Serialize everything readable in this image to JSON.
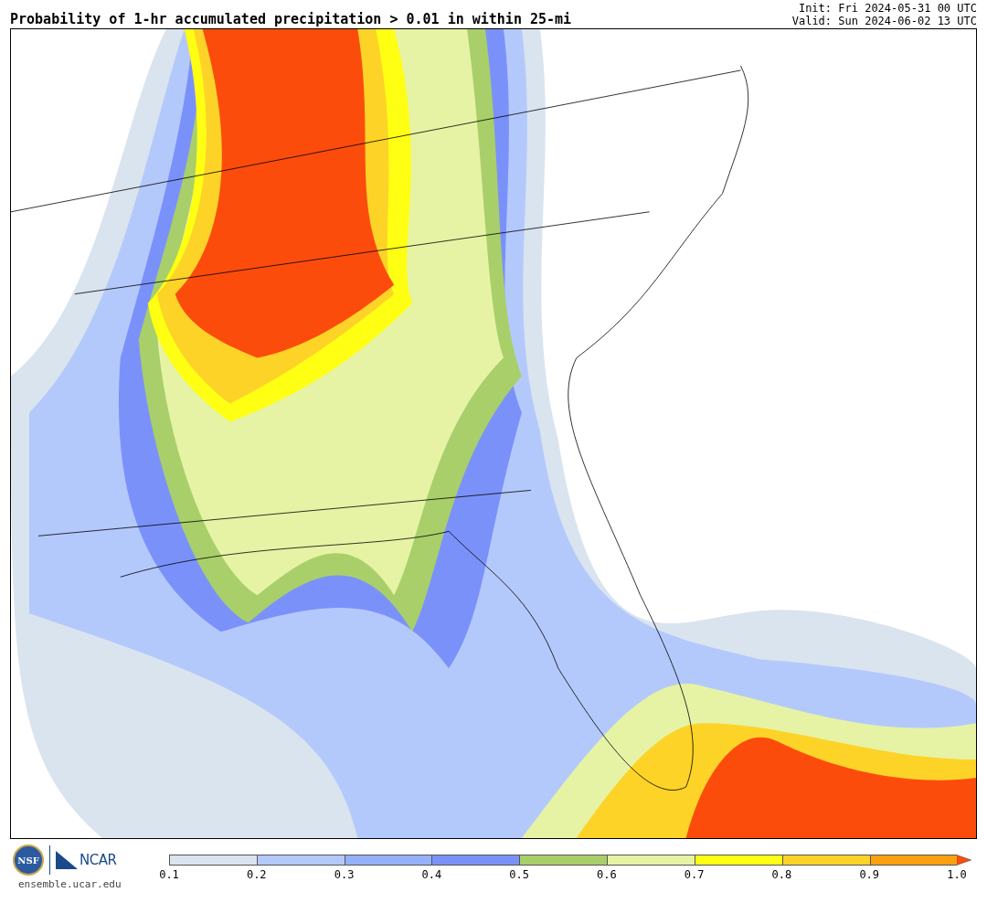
{
  "header": {
    "title": "Probability of 1-hr accumulated precipitation > 0.01 in within 25-mi",
    "init": "Init: Fri 2024-05-31 00 UTC",
    "valid": "Valid: Sun 2024-06-02 13 UTC"
  },
  "footer": {
    "logo_left": "NSF",
    "logo_right": "NCAR",
    "site": "ensemble.ucar.edu"
  },
  "colorbar": {
    "segments": [
      {
        "kind": "band",
        "color": "#d9e4ef"
      },
      {
        "kind": "band",
        "color": "#b4c9fb"
      },
      {
        "kind": "band",
        "color": "#95b1fb"
      },
      {
        "kind": "band",
        "color": "#7b91fa"
      },
      {
        "kind": "band",
        "color": "#a9cf6b"
      },
      {
        "kind": "band",
        "color": "#e6f3a4"
      },
      {
        "kind": "band",
        "color": "#ffff14"
      },
      {
        "kind": "band",
        "color": "#fdd328"
      },
      {
        "kind": "band",
        "color": "#fd9f0e"
      },
      {
        "kind": "arrow",
        "color": "#fb4c0c"
      }
    ],
    "ticks": [
      "0.1",
      "0.2",
      "0.3",
      "0.4",
      "0.5",
      "0.6",
      "0.7",
      "0.8",
      "0.9",
      "1.0"
    ]
  }
}
